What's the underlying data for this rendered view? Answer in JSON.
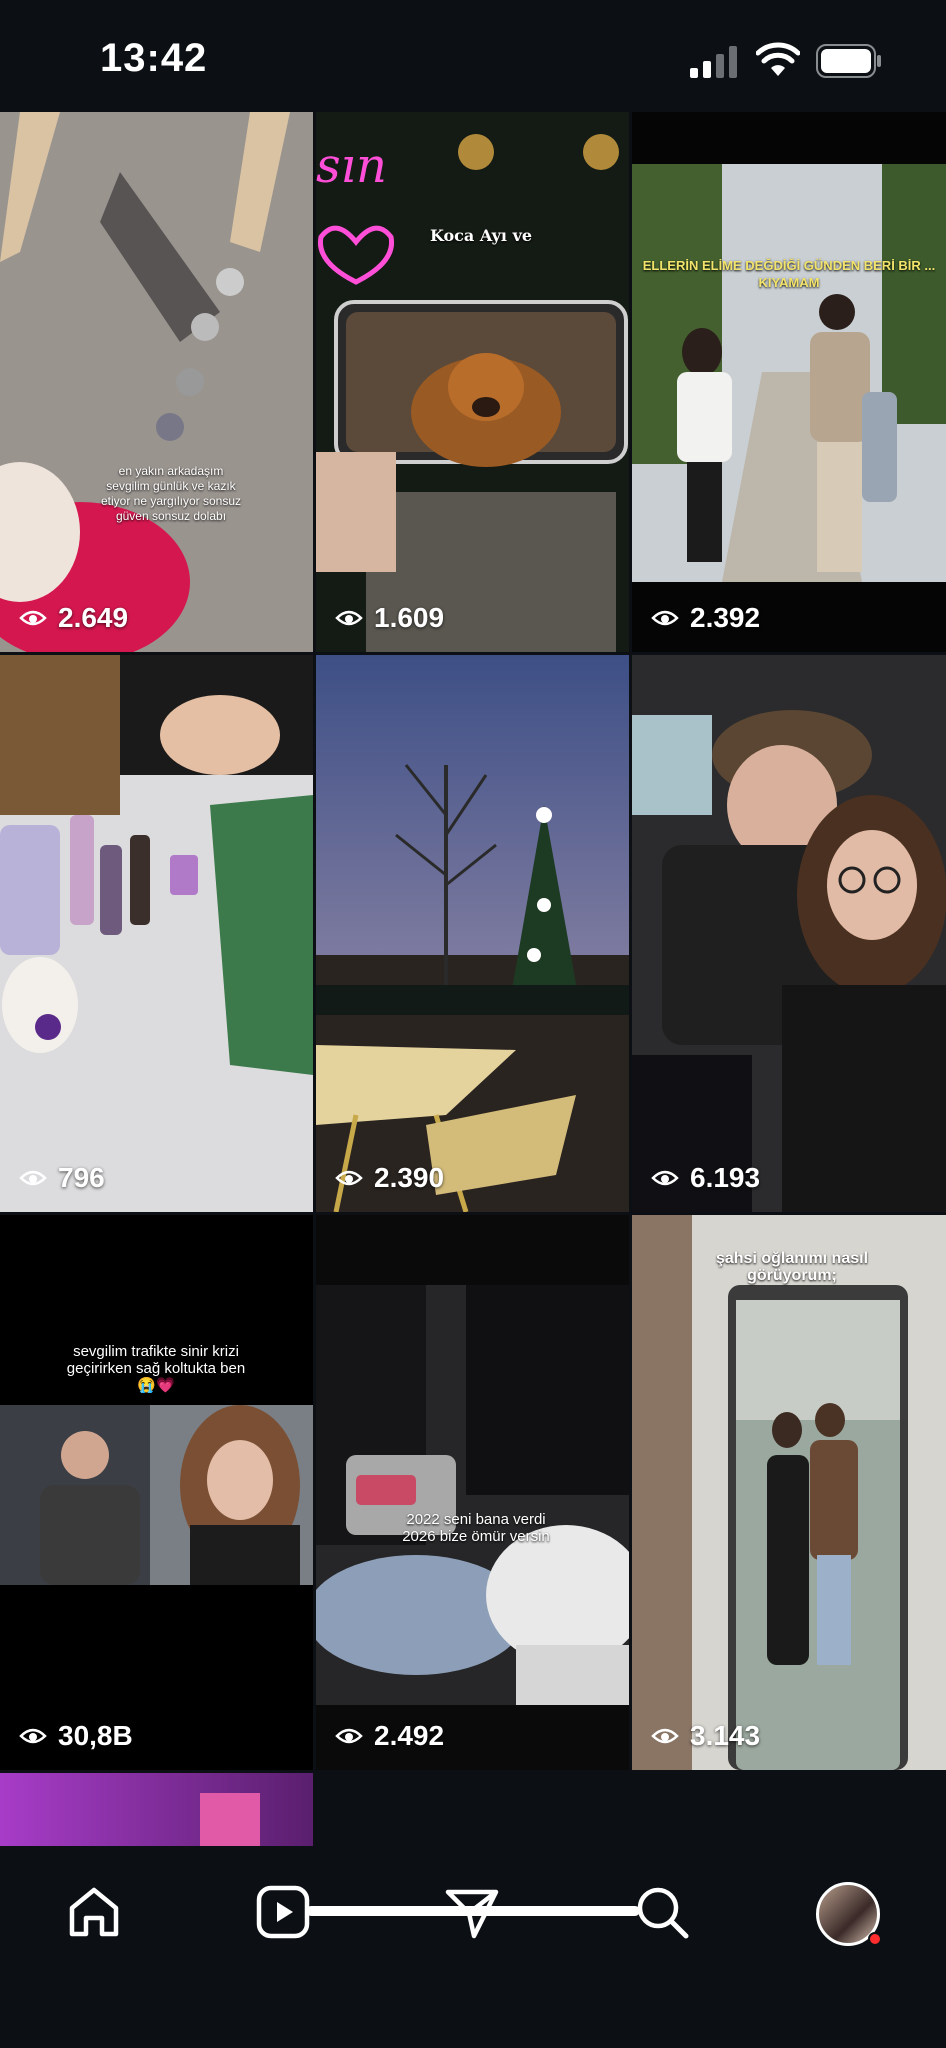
{
  "status_bar": {
    "time": "13:42",
    "icons": [
      "signal-icon",
      "wifi-icon",
      "battery-icon"
    ]
  },
  "reels": [
    {
      "views": "2.649",
      "caption": "en yakın arkadaşım sevgilim günlük ve kazık etiyor ne yargılıyor sonsuz güven sonsuz dolabı"
    },
    {
      "views": "1.609",
      "caption": "Koca Ayı ve"
    },
    {
      "views": "2.392",
      "caption": "ELLERİN ELİME DEĞDİĞİ GÜNDEN BERİ BİR ... KIYAMAM"
    },
    {
      "views": "796",
      "caption": ""
    },
    {
      "views": "2.390",
      "caption": ""
    },
    {
      "views": "6.193",
      "caption": ""
    },
    {
      "views": "30,8B",
      "caption": "sevgilim trafikte sinir krizi geçirirken sağ koltukta ben😭💗"
    },
    {
      "views": "2.492",
      "caption": "2022 seni bana verdi 2026 bize ömür versin"
    },
    {
      "views": "3.143",
      "caption": "şahsi oğlanımı nasıl görüyorum;"
    }
  ],
  "nav": {
    "items": [
      "home-icon",
      "reels-icon",
      "send-icon",
      "search-icon",
      "profile-avatar"
    ]
  },
  "colors": {
    "background": "#0c1014",
    "notification_dot": "#ff2d2d"
  }
}
